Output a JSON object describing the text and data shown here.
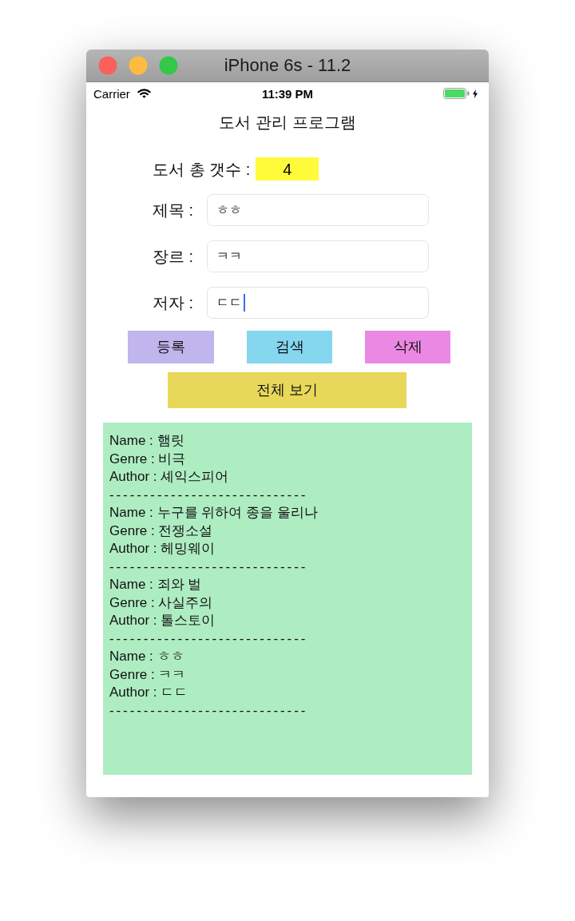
{
  "window": {
    "title": "iPhone 6s - 11.2"
  },
  "status_bar": {
    "carrier": "Carrier",
    "time": "11:39 PM"
  },
  "app_title": "도서 관리 프로그램",
  "book_count": {
    "label": "도서 총 갯수 :",
    "value": "4"
  },
  "fields": [
    {
      "label": "제목 :",
      "value": "ㅎㅎ",
      "focused": false
    },
    {
      "label": "장르 :",
      "value": "ㅋㅋ",
      "focused": false
    },
    {
      "label": "저자 :",
      "value": "ㄷㄷ",
      "focused": true
    }
  ],
  "buttons": [
    {
      "label": "등록",
      "color": "#c0b5ec"
    },
    {
      "label": "검색",
      "color": "#85d6ef"
    },
    {
      "label": "삭제",
      "color": "#eb88e4"
    }
  ],
  "show_all_button": {
    "label": "전체 보기"
  },
  "book_list": {
    "entries": [
      {
        "name": "Name : 햄릿",
        "genre": "Genre : 비극",
        "author": "Author : 셰익스피어",
        "separator": "-----------------------------"
      },
      {
        "name": "Name : 누구를 위하여 종을 울리나",
        "genre": "Genre : 전쟁소설",
        "author": "Author : 헤밍웨이",
        "separator": "-----------------------------"
      },
      {
        "name": "Name : 죄와 벌",
        "genre": "Genre : 사실주의",
        "author": "Author : 톨스토이",
        "separator": "-----------------------------"
      },
      {
        "name": "Name : ㅎㅎ",
        "genre": "Genre : ㅋㅋ",
        "author": "Author : ㄷㄷ",
        "separator": "-----------------------------"
      }
    ]
  }
}
